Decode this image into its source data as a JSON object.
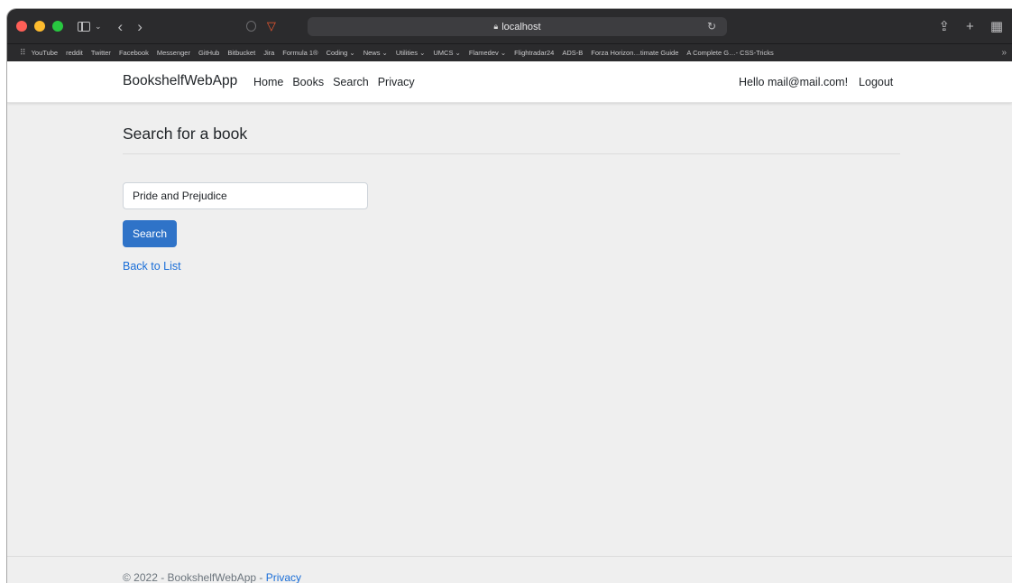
{
  "browser": {
    "url": "localhost",
    "bookmarks": [
      "YouTube",
      "reddit",
      "Twitter",
      "Facebook",
      "Messenger",
      "GitHub",
      "Bitbucket",
      "Jira",
      "Formula 1®",
      "Coding ⌄",
      "News ⌄",
      "Utilities ⌄",
      "UMCS ⌄",
      "Flamedev ⌄",
      "Flightradar24",
      "ADS-B",
      "Forza Horizon…timate Guide",
      "A Complete G…- CSS-Tricks"
    ]
  },
  "navbar": {
    "brand": "BookshelfWebApp",
    "links": [
      "Home",
      "Books",
      "Search",
      "Privacy"
    ],
    "greeting": "Hello mail@mail.com!",
    "logout": "Logout"
  },
  "main": {
    "title": "Search for a book",
    "search_value": "Pride and Prejudice",
    "search_button": "Search",
    "back_link": "Back to List"
  },
  "footer": {
    "text": "© 2022 - BookshelfWebApp - ",
    "privacy": "Privacy"
  }
}
